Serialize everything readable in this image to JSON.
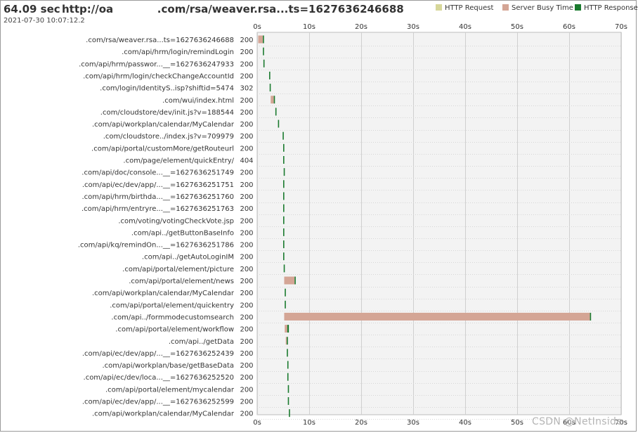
{
  "header": {
    "total_time": "64.09 sec",
    "title": "http://oa            .com/rsa/weaver.rsa...ts=1627636246688",
    "timestamp": "2021-07-30 10:07:12.2"
  },
  "watermark": "CSDN @NetInside",
  "colors": {
    "request": "#d7d79a",
    "server_busy": "#d4a595",
    "response": "#1a7a2e",
    "grid_bg": "#f3f3f3",
    "grid_line": "#cfcfcf"
  },
  "chart_data": {
    "type": "bar",
    "subtype": "waterfall-timeline",
    "title": "http://oa            .com/rsa/weaver.rsa...ts=1627636246688",
    "xlabel": "",
    "ylabel": "",
    "xlim": [
      0,
      70
    ],
    "x_unit": "s",
    "x_ticks": [
      "0s",
      "10s",
      "20s",
      "30s",
      "40s",
      "50s",
      "60s",
      "70s"
    ],
    "grid": true,
    "legend_position": "top-right",
    "series": [
      {
        "name": "HTTP Request",
        "key": "request"
      },
      {
        "name": "Server Busy Time",
        "key": "server_busy"
      },
      {
        "name": "HTTP Response",
        "key": "response"
      }
    ],
    "rows": [
      {
        "label": ".com/rsa/weaver.rsa...ts=1627636246688",
        "status": "200",
        "start": 0.2,
        "busy": 0.9,
        "resp": 0.15
      },
      {
        "label": ".com/api/hrm/login/remindLogin",
        "status": "200",
        "start": 1.1,
        "busy": 0.0,
        "resp": 0.15
      },
      {
        "label": ".com/api/hrm/passwor...__=1627636247933",
        "status": "200",
        "start": 1.2,
        "busy": 0.0,
        "resp": 0.15
      },
      {
        "label": ".com/api/hrm/login/checkChangeAccountId",
        "status": "200",
        "start": 2.3,
        "busy": 0.0,
        "resp": 0.15
      },
      {
        "label": ".com/login/IdentityS..isp?shiftid=5474",
        "status": "302",
        "start": 2.4,
        "busy": 0.0,
        "resp": 0.15
      },
      {
        "label": ".com/wui/index.html",
        "status": "200",
        "start": 2.6,
        "busy": 0.6,
        "resp": 0.2
      },
      {
        "label": ".com/cloudstore/dev/init.js?v=188544",
        "status": "200",
        "start": 3.5,
        "busy": 0.0,
        "resp": 0.15
      },
      {
        "label": ".com/api/workplan/calendar/MyCalendar",
        "status": "200",
        "start": 4.0,
        "busy": 0.0,
        "resp": 0.1
      },
      {
        "label": ".com/cloudstore../index.js?v=709979",
        "status": "200",
        "start": 4.9,
        "busy": 0.0,
        "resp": 0.15
      },
      {
        "label": ".com/api/portal/customMore/getRouteurl",
        "status": "200",
        "start": 5.0,
        "busy": 0.0,
        "resp": 0.15
      },
      {
        "label": ".com/page/element/quickEntry/",
        "status": "404",
        "start": 5.0,
        "busy": 0.0,
        "resp": 0.15
      },
      {
        "label": ".com/api/doc/console...__=1627636251749",
        "status": "200",
        "start": 5.1,
        "busy": 0.0,
        "resp": 0.15
      },
      {
        "label": ".com/api/ec/dev/app/...__=1627636251751",
        "status": "200",
        "start": 5.0,
        "busy": 0.0,
        "resp": 0.15
      },
      {
        "label": ".com/api/hrm/birthda...__=1627636251760",
        "status": "200",
        "start": 5.0,
        "busy": 0.0,
        "resp": 0.15
      },
      {
        "label": ".com/api/hrm/entryre...__=1627636251763",
        "status": "200",
        "start": 5.0,
        "busy": 0.0,
        "resp": 0.15
      },
      {
        "label": ".com/voting/votingCheckVote.jsp",
        "status": "200",
        "start": 5.0,
        "busy": 0.0,
        "resp": 0.15
      },
      {
        "label": ".com/api../getButtonBaseInfo",
        "status": "200",
        "start": 5.0,
        "busy": 0.0,
        "resp": 0.15
      },
      {
        "label": ".com/api/kq/remindOn...__=1627636251786",
        "status": "200",
        "start": 5.0,
        "busy": 0.0,
        "resp": 0.15
      },
      {
        "label": ".com/api../getAutoLoginIM",
        "status": "200",
        "start": 5.0,
        "busy": 0.0,
        "resp": 0.15
      },
      {
        "label": ".com/api/portal/element/picture",
        "status": "200",
        "start": 5.1,
        "busy": 0.0,
        "resp": 0.15
      },
      {
        "label": ".com/api/portal/element/news",
        "status": "200",
        "start": 5.2,
        "busy": 2.0,
        "resp": 0.2
      },
      {
        "label": ".com/api/workplan/calendar/MyCalendar",
        "status": "200",
        "start": 5.3,
        "busy": 0.0,
        "resp": 0.15
      },
      {
        "label": ".com/api/portal/element/quickentry",
        "status": "200",
        "start": 5.3,
        "busy": 0.0,
        "resp": 0.15
      },
      {
        "label": ".com/api../formmodecustomsearch",
        "status": "200",
        "start": 5.2,
        "busy": 58.8,
        "resp": 0.2
      },
      {
        "label": ".com/api/portal/element/workflow",
        "status": "200",
        "start": 5.3,
        "busy": 0.5,
        "resp": 0.3
      },
      {
        "label": ".com/api../getData",
        "status": "200",
        "start": 5.5,
        "busy": 0.2,
        "resp": 0.2
      },
      {
        "label": ".com/api/ec/dev/app/...__=1627636252439",
        "status": "200",
        "start": 5.7,
        "busy": 0.0,
        "resp": 0.15
      },
      {
        "label": ".com/api/workplan/base/getBaseData",
        "status": "200",
        "start": 5.8,
        "busy": 0.0,
        "resp": 0.15
      },
      {
        "label": ".com/api/ec/dev/loca...__=1627636252520",
        "status": "200",
        "start": 5.8,
        "busy": 0.0,
        "resp": 0.15
      },
      {
        "label": ".com/api/portal/element/mycalendar",
        "status": "200",
        "start": 5.9,
        "busy": 0.0,
        "resp": 0.15
      },
      {
        "label": ".com/api/ec/dev/app/...__=1627636252599",
        "status": "200",
        "start": 5.9,
        "busy": 0.0,
        "resp": 0.15
      },
      {
        "label": ".com/api/workplan/calendar/MyCalendar",
        "status": "200",
        "start": 6.1,
        "busy": 0.0,
        "resp": 0.15
      }
    ]
  }
}
